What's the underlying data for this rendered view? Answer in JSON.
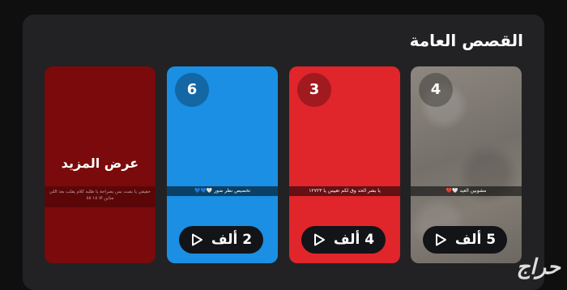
{
  "section": {
    "title": "القصص العامة"
  },
  "cards": [
    {
      "count": "4",
      "caption": "مشوبين العيد 🤍💔",
      "views": "5 ألف"
    },
    {
      "count": "3",
      "caption": "يا بشر الحد وق لكم تعيينن يا ١٢٧٢٣",
      "views": "4 ألف"
    },
    {
      "count": "6",
      "caption": "تخصيص نظر ضور 🤍💙💙",
      "views": "2 ألف"
    }
  ],
  "more": {
    "label": "عرض المزيد",
    "caption": "حقيقي يا بصت بس بصراحة يا طلبه كلام يقلب بعد اللي متاين الا ١٥ ٥٥"
  },
  "watermark": "حراج",
  "icons": {
    "play": "play-icon"
  }
}
